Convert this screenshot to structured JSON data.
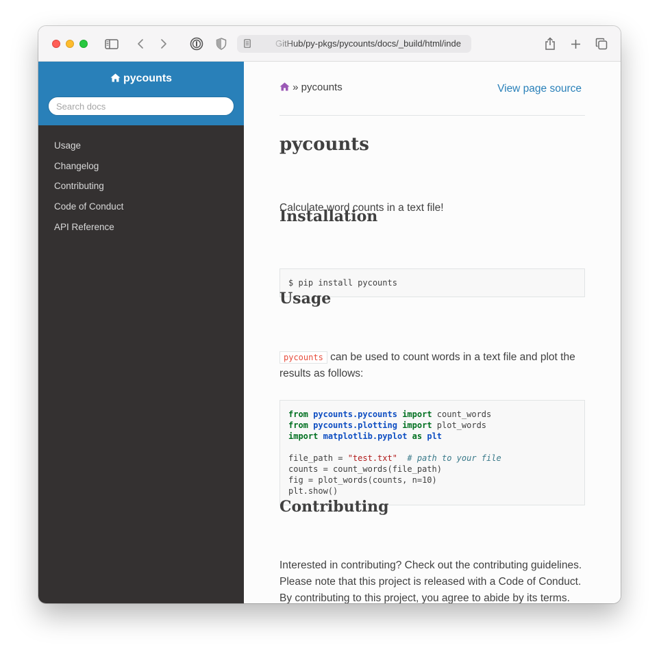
{
  "browser": {
    "url": "GitHub/py-pkgs/pycounts/docs/_build/html/inde"
  },
  "sidebar": {
    "project_name": "pycounts",
    "search_placeholder": "Search docs",
    "items": [
      {
        "label": "Usage"
      },
      {
        "label": "Changelog"
      },
      {
        "label": "Contributing"
      },
      {
        "label": "Code of Conduct"
      },
      {
        "label": "API Reference"
      }
    ]
  },
  "content": {
    "breadcrumb": "» pycounts",
    "view_source": "View page source",
    "title": "pycounts",
    "intro": "Calculate word counts in a text file!",
    "installation": {
      "heading": "Installation",
      "command": "$ pip install pycounts"
    },
    "usage": {
      "heading": "Usage",
      "literal": "pycounts",
      "text": " can be used to count words in a text file and plot the results as follows:",
      "code": {
        "l1_kw": "from",
        "l1_mod": "pycounts.pycounts",
        "l1_imp": "import",
        "l1_name": " count_words",
        "l2_kw": "from",
        "l2_mod": "pycounts.plotting",
        "l2_imp": "import",
        "l2_name": " plot_words",
        "l3_kw": "import",
        "l3_mod": "matplotlib.pyplot",
        "l3_as": "as",
        "l3_alias": "plt",
        "l5_a": "file_path = ",
        "l5_str": "\"test.txt\"",
        "l5_comment": "  # path to your file",
        "l6": "counts = count_words(file_path)",
        "l7": "fig = plot_words(counts, n=10)",
        "l8": "plt.show()"
      }
    },
    "contributing": {
      "heading": "Contributing",
      "text": "Interested in contributing? Check out the contributing guidelines. Please note that this project is released with a Code of Conduct. By contributing to this project, you agree to abide by its terms."
    }
  }
}
